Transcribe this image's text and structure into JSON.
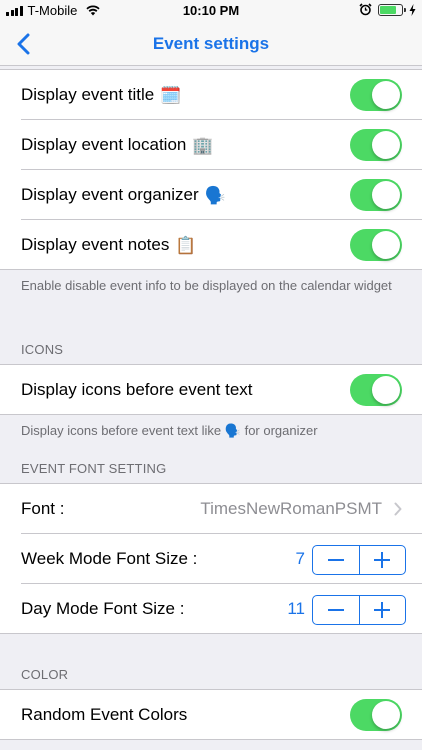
{
  "status": {
    "carrier": "T-Mobile",
    "time": "10:10 PM"
  },
  "nav": {
    "title": "Event settings"
  },
  "display_rows": [
    {
      "label": "Display event title",
      "emoji": "🗓️",
      "on": true
    },
    {
      "label": "Display event location",
      "emoji": "🏢",
      "on": true
    },
    {
      "label": "Display event organizer",
      "emoji": "🗣️",
      "on": true
    },
    {
      "label": "Display event notes",
      "emoji": "📋",
      "on": true
    }
  ],
  "display_footer": "Enable disable event info to be displayed on the calendar widget",
  "icons_section": {
    "header": "ICONS",
    "row_label": "Display icons before event text",
    "footer_before": "Display icons before event text like",
    "footer_emoji": "🗣️",
    "footer_after": "for organizer"
  },
  "font_section": {
    "header": "EVENT FONT SETTING",
    "font_label": "Font :",
    "font_value": "TimesNewRomanPSMT",
    "week_label": "Week Mode Font Size :",
    "week_value": "7",
    "day_label": "Day Mode Font Size :",
    "day_value": "11",
    "minus": "−",
    "plus": "+"
  },
  "color_section": {
    "header": "COLOR",
    "random_label": "Random Event Colors"
  },
  "colors": {
    "accent": "#1a73e8",
    "switch_on": "#4cd964",
    "bg": "#efeff4"
  }
}
